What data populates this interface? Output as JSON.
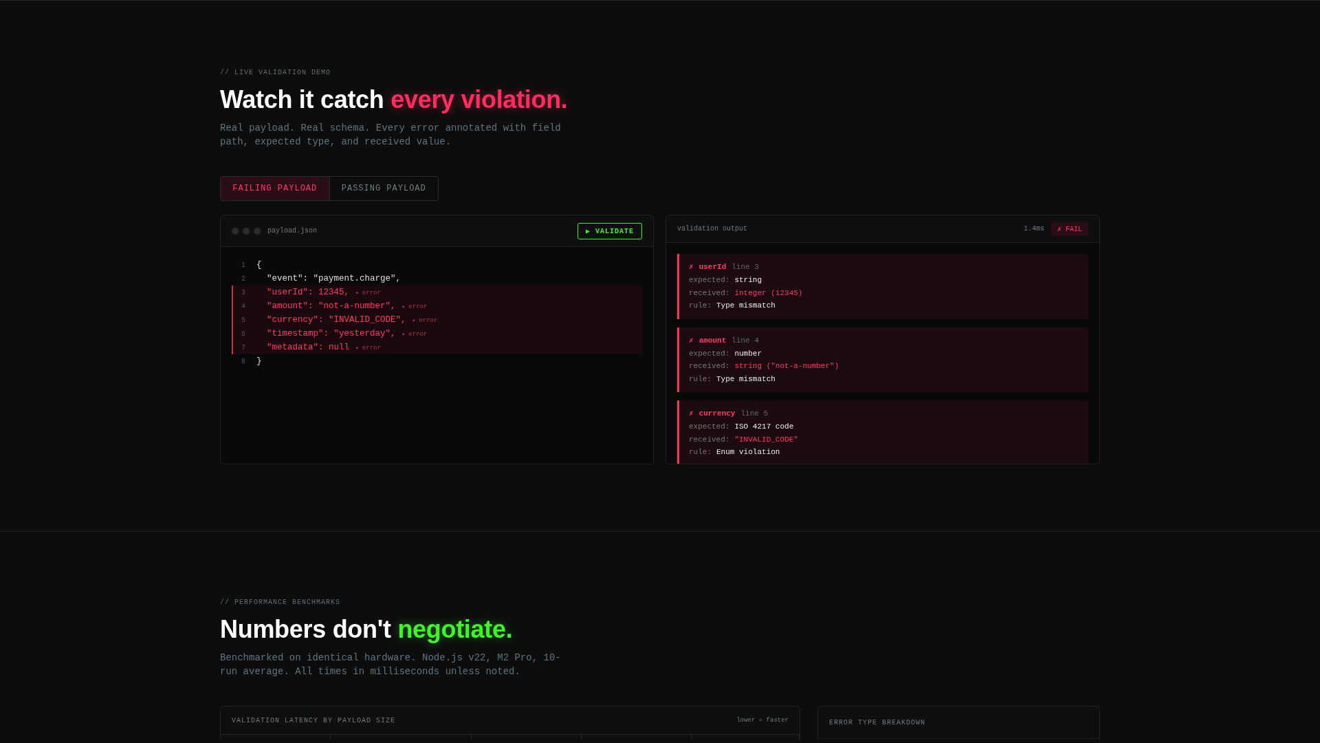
{
  "demo": {
    "eyebrow": "// LIVE VALIDATION DEMO",
    "title": "Watch it catch",
    "title_accent": "every violation.",
    "description": "Real payload. Real schema. Every error annotated with field path, expected type, and received value.",
    "tabs": [
      {
        "label": "FAILING PAYLOAD",
        "selected": true
      },
      {
        "label": "PASSING PAYLOAD",
        "selected": false
      }
    ],
    "editor": {
      "filename": "payload.json",
      "button": "▶ VALIDATE",
      "lines": [
        {
          "number": "1",
          "kind": "brace",
          "text": "{",
          "error": false
        },
        {
          "number": "2",
          "kind": "field",
          "text": "\"event\": \"payment.charge\",",
          "error": false
        },
        {
          "number": "3",
          "kind": "field",
          "text": "\"userId\": 12345,",
          "error": true,
          "note": "◂ error"
        },
        {
          "number": "4",
          "kind": "field",
          "text": "\"amount\": \"not-a-number\",",
          "error": true,
          "note": "◂ error"
        },
        {
          "number": "5",
          "kind": "field",
          "text": "\"currency\": \"INVALID_CODE\",",
          "error": true,
          "note": "◂ error"
        },
        {
          "number": "6",
          "kind": "field",
          "text": "\"timestamp\": \"yesterday\",",
          "error": true,
          "note": "◂ error"
        },
        {
          "number": "7",
          "kind": "field",
          "text": "\"metadata\": null",
          "error": true,
          "note": "◂ error"
        },
        {
          "number": "8",
          "kind": "brace",
          "text": "}",
          "error": false
        }
      ]
    },
    "output": {
      "title": "validation output",
      "time": "1.4ms",
      "status": "✗ FAIL",
      "errors": [
        {
          "mark": "✗",
          "field": "userId",
          "line": "line 3",
          "rows": [
            {
              "label": "expected:",
              "value": "string",
              "kind": "plain"
            },
            {
              "label": "received:",
              "value": "integer (12345)",
              "kind": "bad"
            },
            {
              "label": "rule:",
              "value": "Type mismatch",
              "kind": "plain"
            }
          ]
        },
        {
          "mark": "✗",
          "field": "amount",
          "line": "line 4",
          "rows": [
            {
              "label": "expected:",
              "value": "number",
              "kind": "plain"
            },
            {
              "label": "received:",
              "value": "string (\"not-a-number\")",
              "kind": "bad"
            },
            {
              "label": "rule:",
              "value": "Type mismatch",
              "kind": "plain"
            }
          ]
        },
        {
          "mark": "✗",
          "field": "currency",
          "line": "line 5",
          "rows": [
            {
              "label": "expected:",
              "value": "ISO 4217 code",
              "kind": "plain"
            },
            {
              "label": "received:",
              "value": "\"INVALID_CODE\"",
              "kind": "bad"
            },
            {
              "label": "rule:",
              "value": "Enum violation",
              "kind": "plain"
            }
          ]
        }
      ]
    }
  },
  "benchmarks": {
    "eyebrow": "// PERFORMANCE BENCHMARKS",
    "title": "Numbers don't",
    "title_accent": "negotiate.",
    "description": "Benchmarked on identical hardware. Node.js v22, M2 Pro, 10-run average. All times in milliseconds unless noted.",
    "latency_card": {
      "title": "VALIDATION LATENCY BY PAYLOAD SIZE",
      "note": "lower = faster"
    },
    "breakdown_card": {
      "title": "ERROR TYPE BREAKDOWN"
    }
  }
}
